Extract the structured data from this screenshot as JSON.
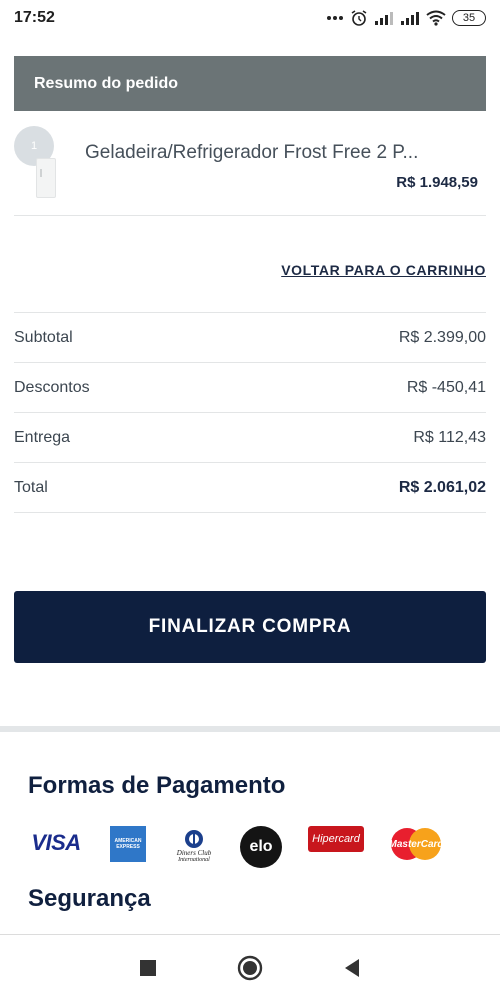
{
  "status_bar": {
    "time": "17:52",
    "battery": "35",
    "icons": [
      "more-dots-icon",
      "alarm-icon",
      "signal-icon",
      "signal-icon",
      "wifi-icon",
      "battery-icon"
    ]
  },
  "summary": {
    "title": "Resumo do pedido",
    "item": {
      "quantity": "1",
      "name": "Geladeira/Refrigerador Frost Free 2 P...",
      "price": "R$ 1.948,59"
    }
  },
  "back_link": "VOLTAR PARA O CARRINHO",
  "totals": {
    "subtotal_label": "Subtotal",
    "subtotal_value": "R$ 2.399,00",
    "discounts_label": "Descontos",
    "discounts_value": "R$ -450,41",
    "delivery_label": "Entrega",
    "delivery_value": "R$ 112,43",
    "total_label": "Total",
    "total_value": "R$ 2.061,02"
  },
  "checkout_button": "FINALIZAR COMPRA",
  "payment": {
    "title": "Formas de Pagamento",
    "visa": "VISA",
    "amex_line1": "AMERICAN",
    "amex_line2": "EXPRESS",
    "diners_line1": "Diners Club",
    "diners_line2": "International",
    "elo": "elo",
    "hipercard": "Hipercard",
    "mastercard": "MasterCard"
  },
  "security": {
    "title": "Segurança"
  },
  "colors": {
    "header_bg": "#6b7476",
    "button_bg": "#0e1f3f",
    "title_color": "#10203f"
  }
}
